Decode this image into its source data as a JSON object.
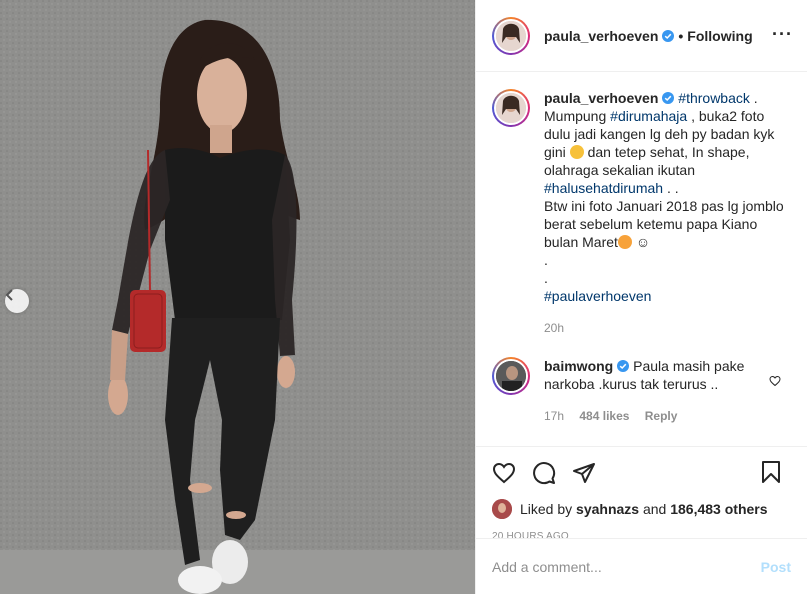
{
  "post": {
    "author": "paula_verhoeven",
    "follow_status": "Following",
    "more_icon": "more-horizontal-icon"
  },
  "caption": {
    "username": "paula_verhoeven",
    "hashtag1": "#throwback",
    "text1": " .",
    "text2": "Mumpung ",
    "hashtag2": "#dirumahaja",
    "text3": " , buka2 foto dulu jadi kangen lg deh py badan kyk gini",
    "text4": " dan tetep sehat, In shape, olahraga sekalian ikutan",
    "hashtag3": "#halusehatdirumah",
    "text5": " . .",
    "text6": "Btw ini foto Januari 2018 pas lg jomblo berat sebelum ketemu papa Kiano bulan Maret",
    "dot1": ".",
    "dot2": ".",
    "hashtag4": "#paulaverhoeven",
    "time": "20h"
  },
  "reply": {
    "username": "baimwong",
    "text": "Paula masih pake narkoba .kurus tak terurus ..",
    "time": "17h",
    "likes": "484 likes",
    "reply_label": "Reply"
  },
  "engagement": {
    "liked_by_prefix": "Liked by ",
    "liked_by_user": "syahnazs",
    "and_text": " and ",
    "others": "186,483 others",
    "time_ago": "20 HOURS AGO"
  },
  "comment_box": {
    "placeholder": "Add a comment...",
    "post_label": "Post"
  },
  "colors": {
    "link": "#00376b",
    "verified": "#3897f0",
    "post_disabled": "#b2dffc"
  }
}
